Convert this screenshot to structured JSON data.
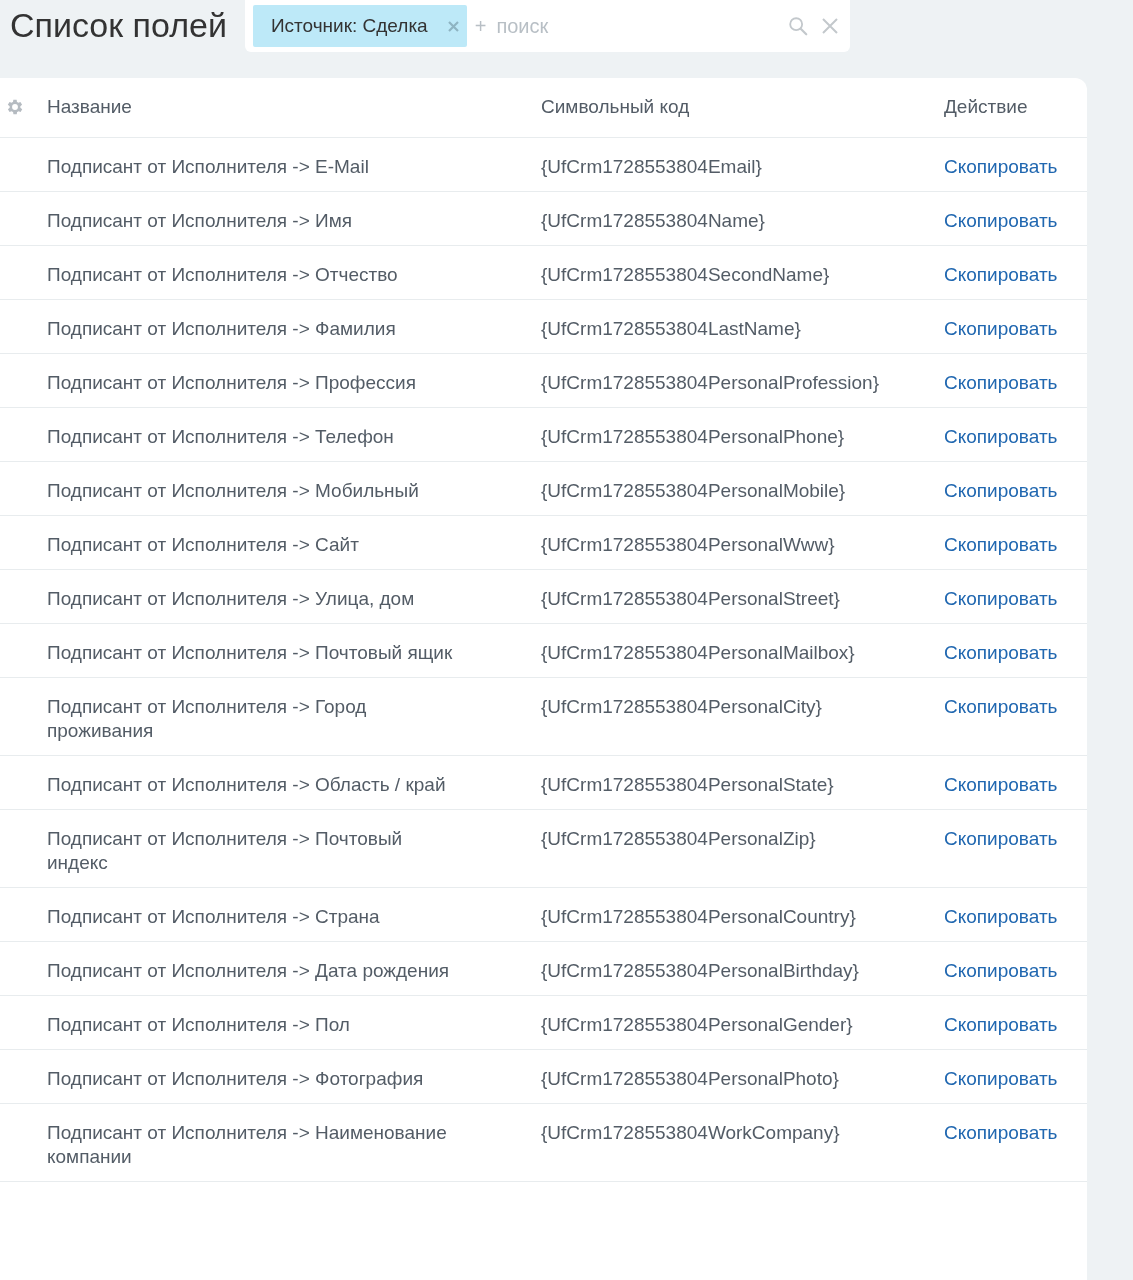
{
  "title": "Список полей",
  "filter": {
    "tag": "Источник: Сделка",
    "add": "+",
    "placeholder": "поиск"
  },
  "table": {
    "columns": [
      "Название",
      "Символьный код",
      "Действие"
    ],
    "rows": [
      {
        "name": "Подписант от Исполнителя -> E-Mail",
        "code": "{UfCrm1728553804Email}",
        "action": "Скопировать"
      },
      {
        "name": "Подписант от Исполнителя -> Имя",
        "code": "{UfCrm1728553804Name}",
        "action": "Скопировать"
      },
      {
        "name": "Подписант от Исполнителя -> Отчество",
        "code": "{UfCrm1728553804SecondName}",
        "action": "Скопировать"
      },
      {
        "name": "Подписант от Исполнителя -> Фамилия",
        "code": "{UfCrm1728553804LastName}",
        "action": "Скопировать"
      },
      {
        "name": "Подписант от Исполнителя -> Профессия",
        "code": "{UfCrm1728553804PersonalProfession}",
        "action": "Скопировать"
      },
      {
        "name": "Подписант от Исполнителя -> Телефон",
        "code": "{UfCrm1728553804PersonalPhone}",
        "action": "Скопировать"
      },
      {
        "name": "Подписант от Исполнителя -> Мобильный",
        "code": "{UfCrm1728553804PersonalMobile}",
        "action": "Скопировать"
      },
      {
        "name": "Подписант от Исполнителя -> Сайт",
        "code": "{UfCrm1728553804PersonalWww}",
        "action": "Скопировать"
      },
      {
        "name": "Подписант от Исполнителя -> Улица, дом",
        "code": "{UfCrm1728553804PersonalStreet}",
        "action": "Скопировать"
      },
      {
        "name": "Подписант от Исполнителя -> Почтовый ящик",
        "code": "{UfCrm1728553804PersonalMailbox}",
        "action": "Скопировать"
      },
      {
        "name": "Подписант от Исполнителя -> Город проживания",
        "code": "{UfCrm1728553804PersonalCity}",
        "action": "Скопировать"
      },
      {
        "name": "Подписант от Исполнителя -> Область / край",
        "code": "{UfCrm1728553804PersonalState}",
        "action": "Скопировать"
      },
      {
        "name": "Подписант от Исполнителя -> Почтовый индекс",
        "code": "{UfCrm1728553804PersonalZip}",
        "action": "Скопировать"
      },
      {
        "name": "Подписант от Исполнителя -> Страна",
        "code": "{UfCrm1728553804PersonalCountry}",
        "action": "Скопировать"
      },
      {
        "name": "Подписант от Исполнителя -> Дата рождения",
        "code": "{UfCrm1728553804PersonalBirthday}",
        "action": "Скопировать"
      },
      {
        "name": "Подписант от Исполнителя -> Пол",
        "code": "{UfCrm1728553804PersonalGender}",
        "action": "Скопировать"
      },
      {
        "name": "Подписант от Исполнителя -> Фотография",
        "code": "{UfCrm1728553804PersonalPhoto}",
        "action": "Скопировать"
      },
      {
        "name": "Подписант от Исполнителя -> Наименование компании",
        "code": "{UfCrm1728553804WorkCompany}",
        "action": "Скопировать"
      }
    ]
  }
}
